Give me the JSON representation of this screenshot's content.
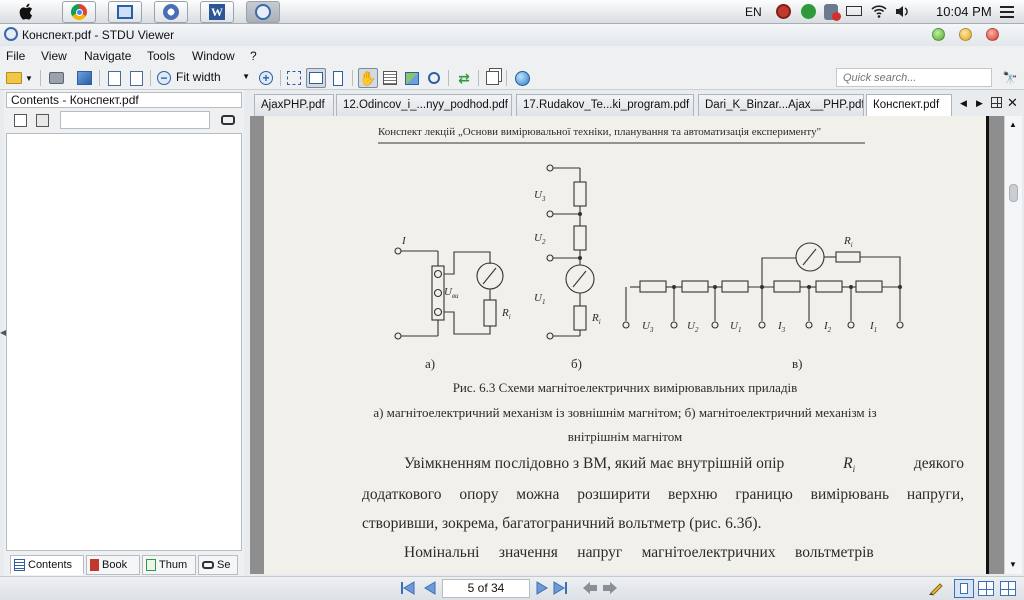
{
  "system_bar": {
    "language": "EN",
    "time": "10:04 PM"
  },
  "window": {
    "title": "Конспект.pdf - STDU Viewer"
  },
  "menu": {
    "file": "File",
    "view": "View",
    "navigate": "Navigate",
    "tools": "Tools",
    "window": "Window",
    "help": "?"
  },
  "toolbar": {
    "zoom_mode": "Fit width",
    "quick_search_placeholder": "Quick search..."
  },
  "left_panel": {
    "header": "Contents - Конспект.pdf",
    "tabs": [
      "Contents",
      "Book",
      "Thum",
      "Se"
    ]
  },
  "doc_tabs": [
    "AjaxPHP.pdf",
    "12.Odincov_i_...nyy_podhod.pdf",
    "17.Rudakov_Te...ki_program.pdf",
    "Dari_K_Binzar...Ajax__PHP.pdf",
    "Конспект.pdf"
  ],
  "document": {
    "header": "Конспект лекцій „Основи вимірювальної техніки, планування та автоматизація експерименту\"",
    "labels_a": {
      "current": "I",
      "voltage": "U",
      "voltage_sub": "ви",
      "resistor": "R",
      "resistor_sub": "i"
    },
    "labels_b": {
      "u3": "U",
      "u3_sub": "3",
      "u2": "U",
      "u2_sub": "2",
      "u1": "U",
      "u1_sub": "1",
      "r": "R",
      "r_sub": "i"
    },
    "labels_c": {
      "r": "R",
      "r_sub": "i",
      "bottom": [
        {
          "t": "U",
          "s": "3"
        },
        {
          "t": "U",
          "s": "2"
        },
        {
          "t": "U",
          "s": "1"
        },
        {
          "t": "I",
          "s": "3"
        },
        {
          "t": "I",
          "s": "2"
        },
        {
          "t": "I",
          "s": "1"
        }
      ]
    },
    "subfig_a": "а)",
    "subfig_b": "б)",
    "subfig_c": "в)",
    "caption_title": "Рис. 6.3 Схеми магнітоелектричних вимірювавльних приладів",
    "caption_line1": "а) магнітоелектричний механізм із зовнішнім магнітом; б) магнітоелектричний механізм із",
    "caption_line2": "внітрішнім магнітом",
    "para1_line1_a": "Увімкненням послідовно з ВМ, який має внутрішній опір",
    "para1_line1_r": "R",
    "para1_line1_rsub": "i",
    "para1_line1_b": "деякого",
    "para1_line2": "додаткового опору можна розширити верхню границю вимірювань напруги,",
    "para1_line3": "створивши, зокрема, багатограничний вольтметр (рис. 6.3б).",
    "para2_line1": "Номінальні     значення     напруг     магнітоелектричних     вольтметрів"
  },
  "status": {
    "page_indicator": "5 of 34"
  }
}
